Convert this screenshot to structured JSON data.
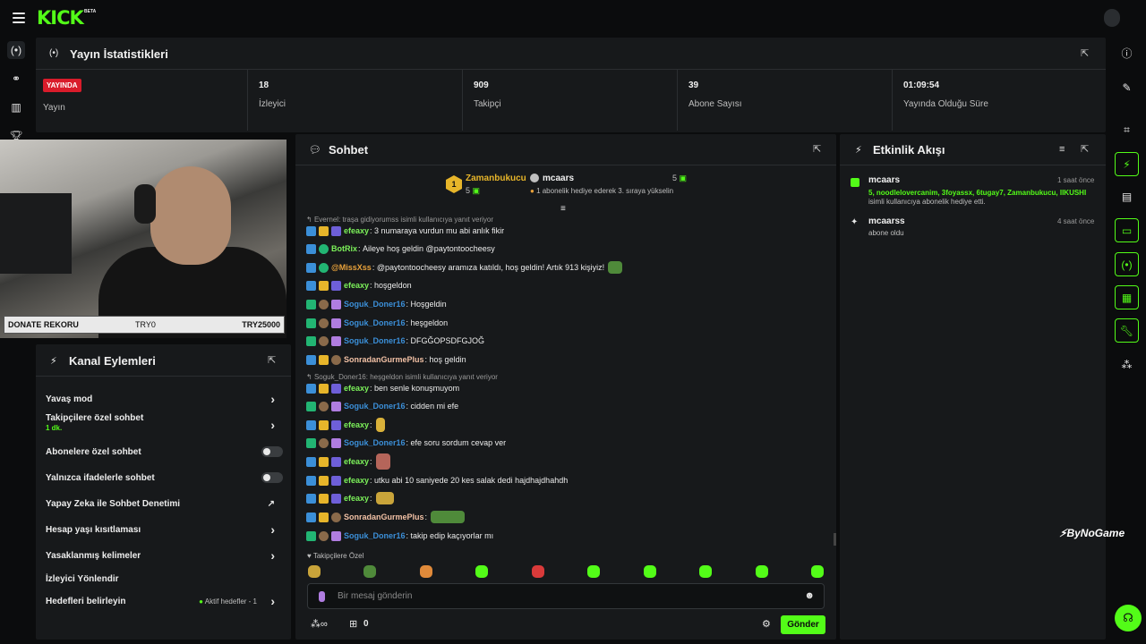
{
  "app": {
    "brand": "KICK",
    "beta": "BETA",
    "accent": "#53fc18"
  },
  "stats": {
    "title": "Yayın İstatistikleri",
    "live_badge": "YAYINDA",
    "items": [
      {
        "label": "Yayın"
      },
      {
        "value": "18",
        "label": "İzleyici"
      },
      {
        "value": "909",
        "label": "Takipçi"
      },
      {
        "value": "39",
        "label": "Abone Sayısı"
      },
      {
        "value": "01:09:54",
        "label": "Yayında Olduğu Süre"
      }
    ]
  },
  "overlay": {
    "left": "DONATE REKORU",
    "mid": "TRY0",
    "right": "TRY25000"
  },
  "actions": {
    "title": "Kanal Eylemleri",
    "items": [
      {
        "label": "Yavaş mod"
      },
      {
        "label": "Takipçilere özel sohbet",
        "sub": "1 dk."
      },
      {
        "label": "Abonelere özel sohbet"
      },
      {
        "label": "Yalnızca ifadelerle sohbet"
      },
      {
        "label": "Yapay Zeka ile Sohbet Denetimi"
      },
      {
        "label": "Hesap yaşı kısıtlaması"
      },
      {
        "label": "Yasaklanmış kelimeler"
      },
      {
        "label": "İzleyici Yönlendir"
      },
      {
        "label": "Hedefleri belirleyin",
        "badge": "Aktif hedefler - 1"
      }
    ]
  },
  "chat": {
    "title": "Sohbet",
    "leaders": {
      "first": {
        "rank": "1",
        "name": "Zamanbukucu",
        "count": "5"
      },
      "second": {
        "name": "mcaars",
        "count": "5",
        "note": "1 abonelik hediye ederek 3. sıraya yükselin"
      }
    },
    "reply1": "Evernel: traşa gidiyorumss isimli kullanıcıya yanıt veriyor",
    "reply2": "Soguk_Doner16: heşgeldon isimli kullanıcıya yanıt veriyor",
    "messages": [
      {
        "user": "efeaxy",
        "color": "#7cf25a",
        "text": "3 numaraya vurdun mu abi anlık fikir"
      },
      {
        "user": "BotRix",
        "color": "#7cf25a",
        "text": "Aileye hoş geldin @paytontoocheesy"
      },
      {
        "user": "@MissXss",
        "color": "#e9a23b",
        "text": "@paytontoocheesy aramıza katıldı, hoş geldin! Artık 913 kişiyiz!"
      },
      {
        "user": "efeaxy",
        "color": "#7cf25a",
        "text": "hoşgeldon"
      },
      {
        "user": "Soguk_Doner16",
        "color": "#3b8fd8",
        "text": "Hoşgeldin"
      },
      {
        "user": "Soguk_Doner16",
        "color": "#3b8fd8",
        "text": "heşgeldon"
      },
      {
        "user": "Soguk_Doner16",
        "color": "#3b8fd8",
        "text": "DFGĞOPSDFGJOĞ"
      },
      {
        "user": "SonradanGurmePlus",
        "color": "#f2c1a5",
        "text": "hoş geldin"
      },
      {
        "user": "efeaxy",
        "color": "#7cf25a",
        "text": "ben senle konuşmuyom"
      },
      {
        "user": "Soguk_Doner16",
        "color": "#3b8fd8",
        "text": "cidden mi efe"
      },
      {
        "user": "efeaxy",
        "color": "#7cf25a",
        "text": ""
      },
      {
        "user": "Soguk_Doner16",
        "color": "#3b8fd8",
        "text": "efe soru sordum cevap ver"
      },
      {
        "user": "efeaxy",
        "color": "#7cf25a",
        "text": ""
      },
      {
        "user": "efeaxy",
        "color": "#7cf25a",
        "text": "utku abi 10 saniyede 20 kes salak dedi hajdhajdhahdh"
      },
      {
        "user": "efeaxy",
        "color": "#7cf25a",
        "text": ""
      },
      {
        "user": "SonradanGurmePlus",
        "color": "#f2c1a5",
        "text": ""
      },
      {
        "user": "Soguk_Doner16",
        "color": "#3b8fd8",
        "text": "takip edip kaçıyorlar mı"
      }
    ],
    "emote_label": "Takipçilere Özel",
    "placeholder": "Bir mesaj gönderin",
    "points": "0",
    "send": "Gönder"
  },
  "activity": {
    "title": "Etkinlik Akışı",
    "items": [
      {
        "user": "mcaars",
        "time": "1 saat önce",
        "highlight": "5, noodlelovercanim, 3foyassx, 6tugay7, Zamanbukucu, IIKUSHI",
        "text": "isimli kullanıcıya abonelik hediye etti."
      },
      {
        "user": "mcaarss",
        "time": "4 saat önce",
        "text": "abone oldu"
      }
    ]
  },
  "watermark": "ByNoGame"
}
